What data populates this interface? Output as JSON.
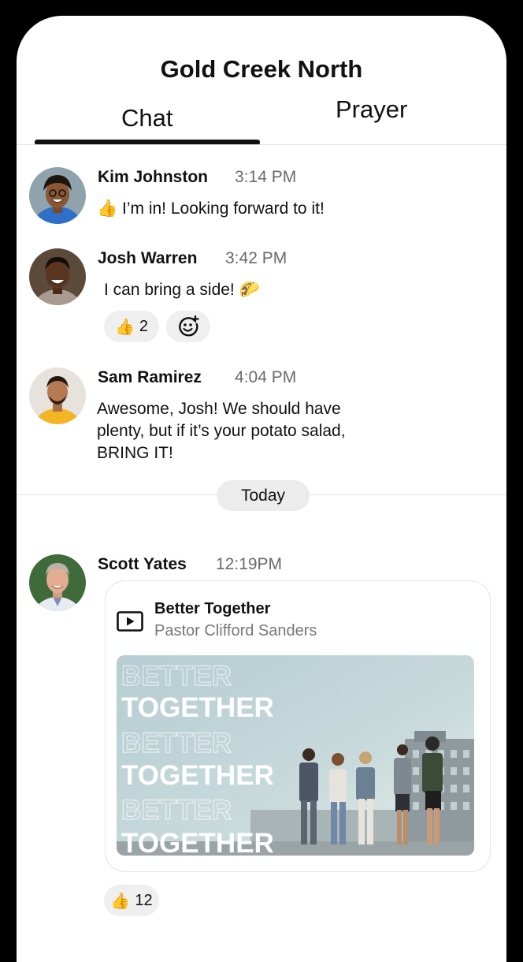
{
  "header": {
    "title": "Gold Creek North"
  },
  "tabs": [
    {
      "label": "Chat",
      "active": true
    },
    {
      "label": "Prayer",
      "active": false
    }
  ],
  "messages": [
    {
      "author": "Kim Johnston",
      "time": "3:14 PM",
      "emoji": "👍",
      "text": "I’m in! Looking forward to it!"
    },
    {
      "author": "Josh Warren",
      "time": "3:42 PM",
      "text": "I can bring a side!",
      "emoji": "🌮",
      "reaction_emoji": "👍",
      "reaction_count": "2",
      "add_reaction_icon": "emoji-add-icon"
    },
    {
      "author": "Sam Ramirez",
      "time": "4:04 PM",
      "lines": [
        "Awesome, Josh! We should have",
        "plenty, but if it’s your potato salad,",
        "BRING IT!"
      ]
    }
  ],
  "divider": {
    "label": "Today"
  },
  "post": {
    "author": "Scott Yates",
    "time": "12:19PM",
    "card_title": "Better Together",
    "card_subtitle": "Pastor Clifford Sanders",
    "card_icon": "video-play-icon",
    "banner_words": [
      "BETTER",
      "TOGETHER",
      "BETTER",
      "TOGETHER",
      "BETTER",
      "TOGETHER"
    ],
    "reaction_emoji": "👍",
    "reaction_count": "12"
  },
  "colors": {
    "accent": "#111111",
    "muted_text": "#6a6a6a",
    "pill_bg": "#efefef",
    "banner_bg": "#b9d0d4"
  }
}
